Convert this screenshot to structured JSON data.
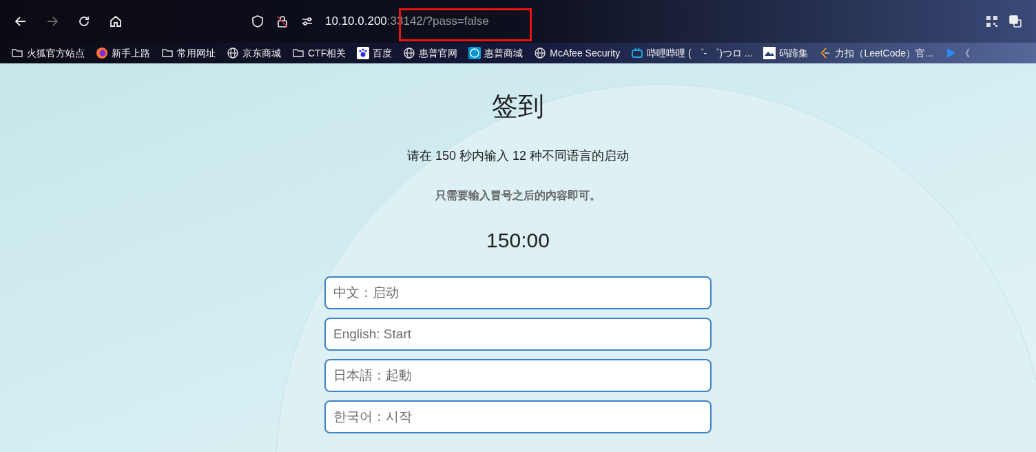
{
  "toolbar": {
    "url": {
      "host": "10.10.0.200",
      "rest": ":33142/?pass=false"
    },
    "forward_disabled": true
  },
  "bookmarks": [
    {
      "kind": "folder",
      "label": "火狐官方站点"
    },
    {
      "kind": "firefox",
      "label": "新手上路"
    },
    {
      "kind": "folder",
      "label": "常用网址"
    },
    {
      "kind": "globe",
      "label": "京东商城"
    },
    {
      "kind": "folder",
      "label": "CTF相关"
    },
    {
      "kind": "paw",
      "label": "百度"
    },
    {
      "kind": "globe",
      "label": "惠普官网"
    },
    {
      "kind": "hp",
      "label": "惠普商城"
    },
    {
      "kind": "globe",
      "label": "McAfee Security"
    },
    {
      "kind": "tv",
      "label": "哔哩哔哩 ( ゜- ゜)つロ ..."
    },
    {
      "kind": "image",
      "label": "码蹄集"
    },
    {
      "kind": "leetcode",
      "label": "力扣（LeetCode）官..."
    },
    {
      "kind": "play",
      "label": "《"
    }
  ],
  "page": {
    "title": "签到",
    "instruction": "请在 150 秒内输入 12 种不同语言的启动",
    "note": "只需要输入冒号之后的内容即可。",
    "timer": "150:00",
    "fields": [
      {
        "placeholder": "中文：启动"
      },
      {
        "placeholder": "English: Start"
      },
      {
        "placeholder": "日本語：起動"
      },
      {
        "placeholder": "한국어：시작"
      }
    ]
  }
}
